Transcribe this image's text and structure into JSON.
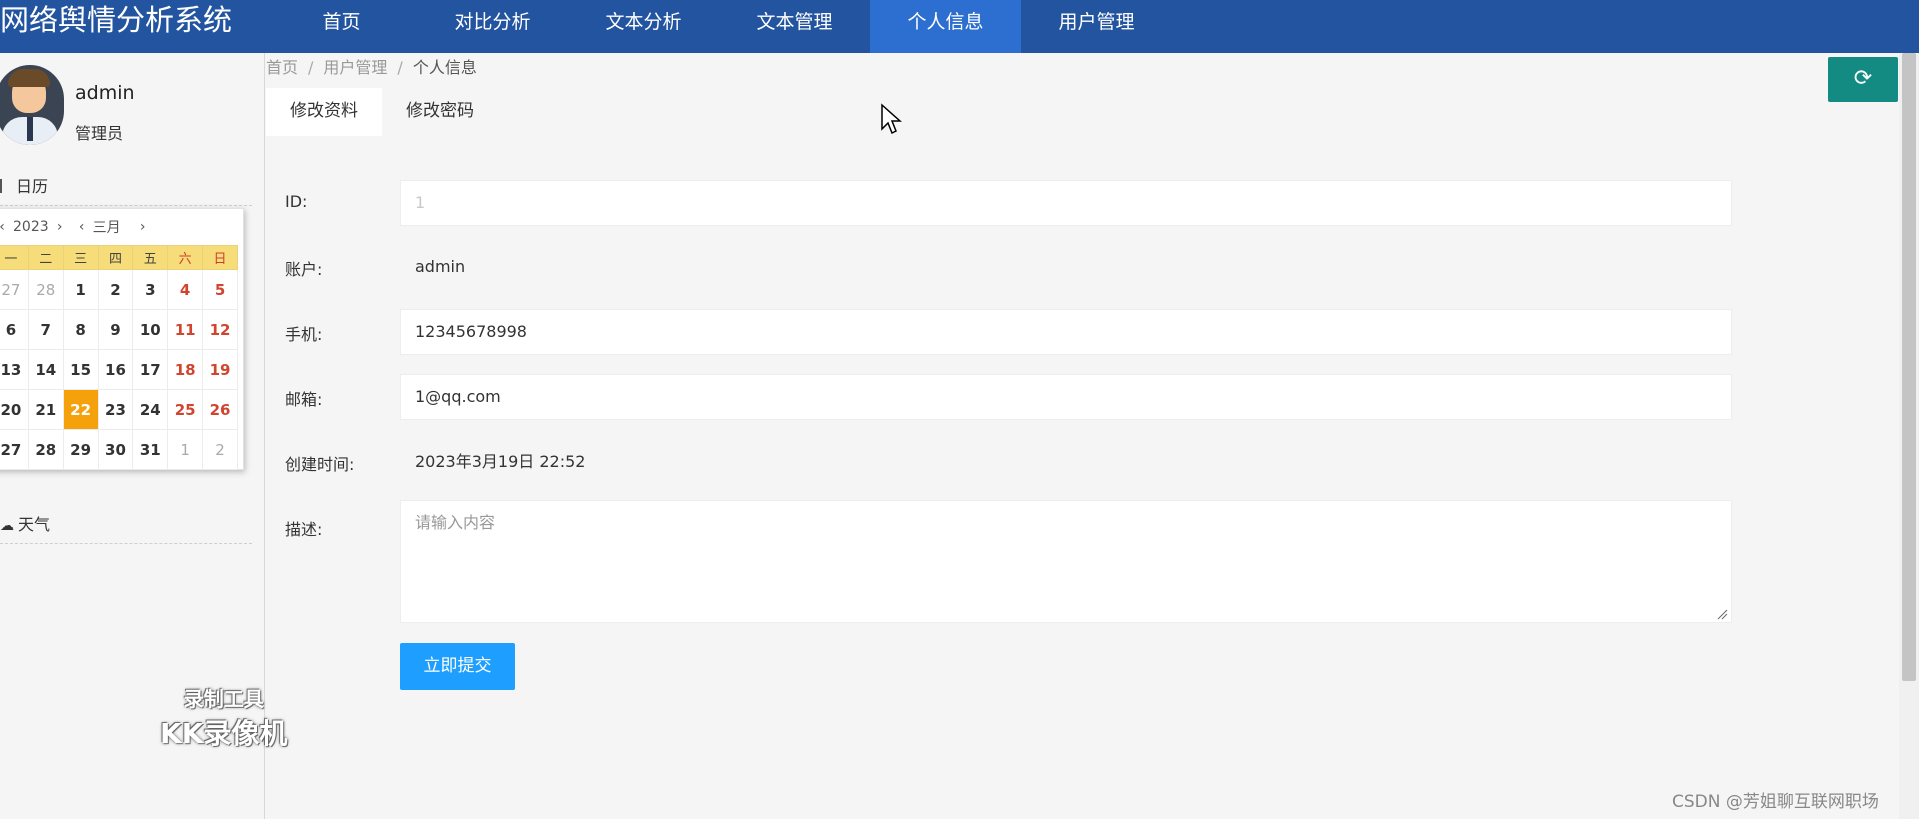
{
  "app": {
    "title": "网络舆情分析系统"
  },
  "nav": {
    "items": [
      {
        "label": "首页"
      },
      {
        "label": "对比分析"
      },
      {
        "label": "文本分析"
      },
      {
        "label": "文本管理"
      },
      {
        "label": "个人信息",
        "active": true
      },
      {
        "label": "用户管理"
      }
    ]
  },
  "sidebar": {
    "user_name": "admin",
    "user_role": "管理员",
    "calendar_label": "日历",
    "weather_label": "天气",
    "calendar": {
      "year": "2023",
      "month": "三月",
      "weekdays": [
        "一",
        "二",
        "三",
        "四",
        "五",
        "六",
        "日"
      ],
      "weeks": [
        [
          "27",
          "28",
          "1",
          "2",
          "3",
          "4",
          "5"
        ],
        [
          "6",
          "7",
          "8",
          "9",
          "10",
          "11",
          "12"
        ],
        [
          "13",
          "14",
          "15",
          "16",
          "17",
          "18",
          "19"
        ],
        [
          "20",
          "21",
          "22",
          "23",
          "24",
          "25",
          "26"
        ],
        [
          "27",
          "28",
          "29",
          "30",
          "31",
          "1",
          "2"
        ]
      ],
      "today": "22"
    }
  },
  "breadcrumb": {
    "items": [
      "首页",
      "用户管理",
      "个人信息"
    ],
    "separator": "/"
  },
  "tabs": [
    {
      "label": "修改资料",
      "active": true
    },
    {
      "label": "修改密码"
    }
  ],
  "form": {
    "id_label": "ID:",
    "id_value": "1",
    "account_label": "账户:",
    "account_value": "admin",
    "phone_label": "手机:",
    "phone_value": "12345678998",
    "email_label": "邮箱:",
    "email_value": "1@qq.com",
    "created_label": "创建时间:",
    "created_value": "2023年3月19日 22:52",
    "desc_label": "描述:",
    "desc_placeholder": "请输入内容",
    "submit_label": "立即提交"
  },
  "watermark": {
    "line1": "录制工具",
    "line2": "KK录像机"
  },
  "csdn_credit": "CSDN @芳姐聊互联网职场",
  "colors": {
    "topbar": "#23549f",
    "nav_active": "#2d6fd0",
    "submit": "#1e9fff",
    "refresh": "#138a82",
    "today": "#f5a10c"
  }
}
